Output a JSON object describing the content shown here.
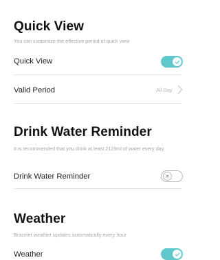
{
  "quick_view": {
    "title": "Quick View",
    "description": "You can customize the effective period of quick view",
    "toggle_label": "Quick View",
    "toggle_on": true,
    "valid_period_label": "Valid Period",
    "valid_period_value": "All Day"
  },
  "drink_water": {
    "title": "Drink Water Reminder",
    "description": "It is recommended that you drink at least 2119ml of water every day",
    "toggle_label": "Drink Water Reminder",
    "toggle_on": false
  },
  "weather": {
    "title": "Weather",
    "description": "Bracelet weather updates automatically every hour",
    "toggle_label": "Weather",
    "toggle_on": true
  },
  "colors": {
    "accent": "#5fc8cb",
    "divider": "#e2e2e2",
    "secondary_text": "#a6a6a6"
  },
  "icons": [
    "check-icon",
    "x-icon",
    "chevron-right-icon"
  ]
}
